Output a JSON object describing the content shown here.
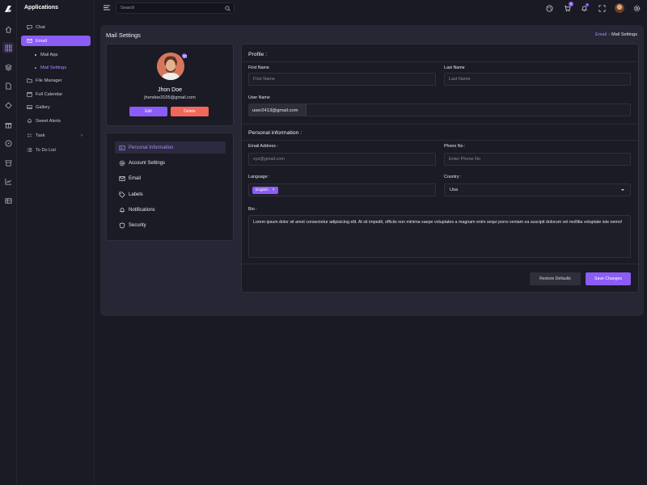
{
  "app": {
    "title": "Applications"
  },
  "sidebar": {
    "items": [
      {
        "label": "Chat",
        "icon": "chat-icon"
      },
      {
        "label": "Email",
        "icon": "mail-icon",
        "active": true
      },
      {
        "label": "Mail App",
        "sub": true
      },
      {
        "label": "Mail Settings",
        "sub": true,
        "current": true
      },
      {
        "label": "File Manager",
        "icon": "folder-icon"
      },
      {
        "label": "Full Calendar",
        "icon": "calendar-icon"
      },
      {
        "label": "Gallery",
        "icon": "image-icon"
      },
      {
        "label": "Sweet Alerts",
        "icon": "bell-icon"
      },
      {
        "label": "Task",
        "icon": "task-icon",
        "has_children": true
      },
      {
        "label": "To Do List",
        "icon": "list-icon"
      }
    ]
  },
  "rail": {
    "icons": [
      "home-icon",
      "apps-icon",
      "layers-icon",
      "file-icon",
      "components-icon",
      "gift-icon",
      "compass-icon",
      "store-icon",
      "chart-icon",
      "table-icon"
    ]
  },
  "header": {
    "search_placeholder": "Search",
    "icons": [
      "palette-icon",
      "cart-icon",
      "notification-icon",
      "fullscreen-icon",
      "user-avatar",
      "settings-icon"
    ],
    "cart_badge": "5"
  },
  "page": {
    "title": "Mail Settings",
    "breadcrumb_link": "Email",
    "breadcrumb_current": "Mail Settings"
  },
  "profile": {
    "name": "Jhon Doe",
    "email": "jhondoe3105@gmail.com",
    "edit_label": "Edit",
    "delete_label": "Delete"
  },
  "settings_nav": [
    {
      "label": "Personal Information",
      "icon": "id-card-icon",
      "active": true
    },
    {
      "label": "Account Settings",
      "icon": "gear-icon"
    },
    {
      "label": "Email",
      "icon": "mail-icon"
    },
    {
      "label": "Labels",
      "icon": "tag-icon"
    },
    {
      "label": "Notifications",
      "icon": "bell-icon"
    },
    {
      "label": "Security",
      "icon": "shield-icon"
    }
  ],
  "form": {
    "profile_title": "Profile :",
    "first_name_label": "First Name",
    "first_name_placeholder": "First Name",
    "last_name_label": "Last Name",
    "last_name_placeholder": "Last Name",
    "username_label": "User Name",
    "username_value": "user2413@gmail.com",
    "personal_title": "Personal information :",
    "email_label": "Email Address :",
    "email_placeholder": "xyz@gmail.com",
    "phone_label": "Phone No :",
    "phone_placeholder": "Enter Phone No",
    "language_label": "Language :",
    "language_tag": "English",
    "country_label": "Country :",
    "country_value": "Usa",
    "bio_label": "Bio :",
    "bio_value": "Lorem ipsum dolor sit amet consectetur adipisicing elit. At sit impedit, officiis non minima saepe voluptates a magnam enim sequi porro veniam ea suscipit dolorum vel mollitia voluptate iste nemo!",
    "restore_label": "Restore Defaults",
    "save_label": "Save Changes"
  },
  "colors": {
    "accent": "#8b5cf6",
    "danger": "#f2675a",
    "background": "#1a1a24",
    "card": "#1b1b25"
  }
}
